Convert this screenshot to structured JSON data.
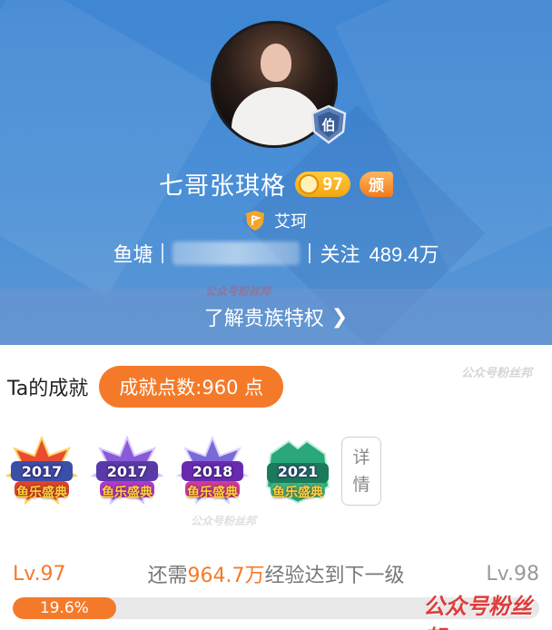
{
  "profile": {
    "username": "七哥张琪格",
    "level_badge": "97",
    "fans_badge": "颁",
    "guild_name": "艾珂",
    "stats": {
      "fishpond_label": "鱼塘",
      "follow_label": "关注",
      "follow_count": "489.4万"
    },
    "privilege_link": "了解贵族特权",
    "noble_badge_icon": "noble-rank-badge"
  },
  "achievements": {
    "title": "Ta的成就",
    "points": "成就点数:960 点",
    "badges": [
      {
        "year": "2017",
        "label": "鱼乐盛典"
      },
      {
        "year": "2017",
        "label": "鱼乐盛典"
      },
      {
        "year": "2018",
        "label": "鱼乐盛典"
      },
      {
        "year": "2021",
        "label": "鱼乐盛典"
      }
    ],
    "detail_button": [
      "详",
      "情"
    ]
  },
  "level": {
    "current": "Lv.97",
    "next": "Lv.98",
    "exp_prefix": "还需",
    "exp_value": "964.7万",
    "exp_suffix": "经验达到下一级",
    "progress_label": "19.6%",
    "progress_value": 0.196
  },
  "watermarks": [
    "公众号粉丝邦",
    "公众号粉丝邦",
    "公众号粉丝邦",
    "公众号粉丝邦"
  ],
  "colors": {
    "hero_blue": "#4a8fd6",
    "accent_orange": "#f47a2a",
    "level_gold": "#f2a612"
  }
}
